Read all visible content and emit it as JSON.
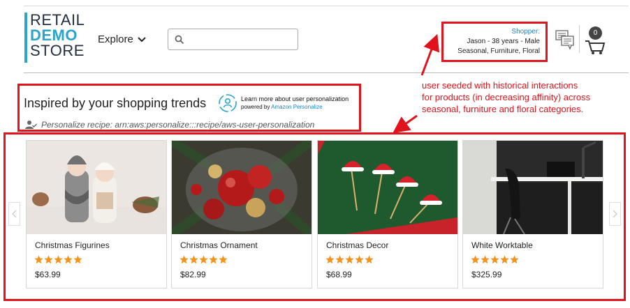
{
  "logo": {
    "line1": "RETAIL",
    "line2": "DEMO",
    "line3": "STORE"
  },
  "nav": {
    "explore_label": "Explore"
  },
  "search": {
    "placeholder": "",
    "value": ""
  },
  "shopper": {
    "label": "Shopper:",
    "line1": "Jason - 38 years - Male",
    "line2": "Seasonal, Furniture, Floral"
  },
  "cart": {
    "count": "0"
  },
  "section": {
    "title": "Inspired by your shopping trends",
    "learn_more": "Learn more about user personalization",
    "powered_by": "powered by",
    "powered_brand": "Amazon Personalize",
    "recipe": "Personalize recipe: arn:aws:personalize:::recipe/aws-user-personalization"
  },
  "annotation": {
    "lines": [
      "user seeded with historical interactions",
      "for products (in decreasing affinity) across",
      "seasonal, furniture and floral categories."
    ]
  },
  "products": [
    {
      "name": "Christmas Figurines",
      "price": "$63.99",
      "rating": 5,
      "image": "christmas-figurines-photo"
    },
    {
      "name": "Christmas Ornament",
      "price": "$82.99",
      "rating": 5,
      "image": "christmas-ornament-photo"
    },
    {
      "name": "Christmas Decor",
      "price": "$68.99",
      "rating": 5,
      "image": "christmas-decor-photo"
    },
    {
      "name": "White Worktable",
      "price": "$325.99",
      "rating": 5,
      "image": "white-worktable-photo"
    }
  ],
  "colors": {
    "accent": "#2aa5c9",
    "annotation": "#e0121b",
    "link": "#1d82c9",
    "star": "#f0941f"
  },
  "icons": [
    "search-icon",
    "chevron-down-icon",
    "chat-icon",
    "cart-icon",
    "personalize-icon",
    "user-check-icon",
    "chevron-left-icon",
    "chevron-right-icon",
    "star-icon"
  ]
}
